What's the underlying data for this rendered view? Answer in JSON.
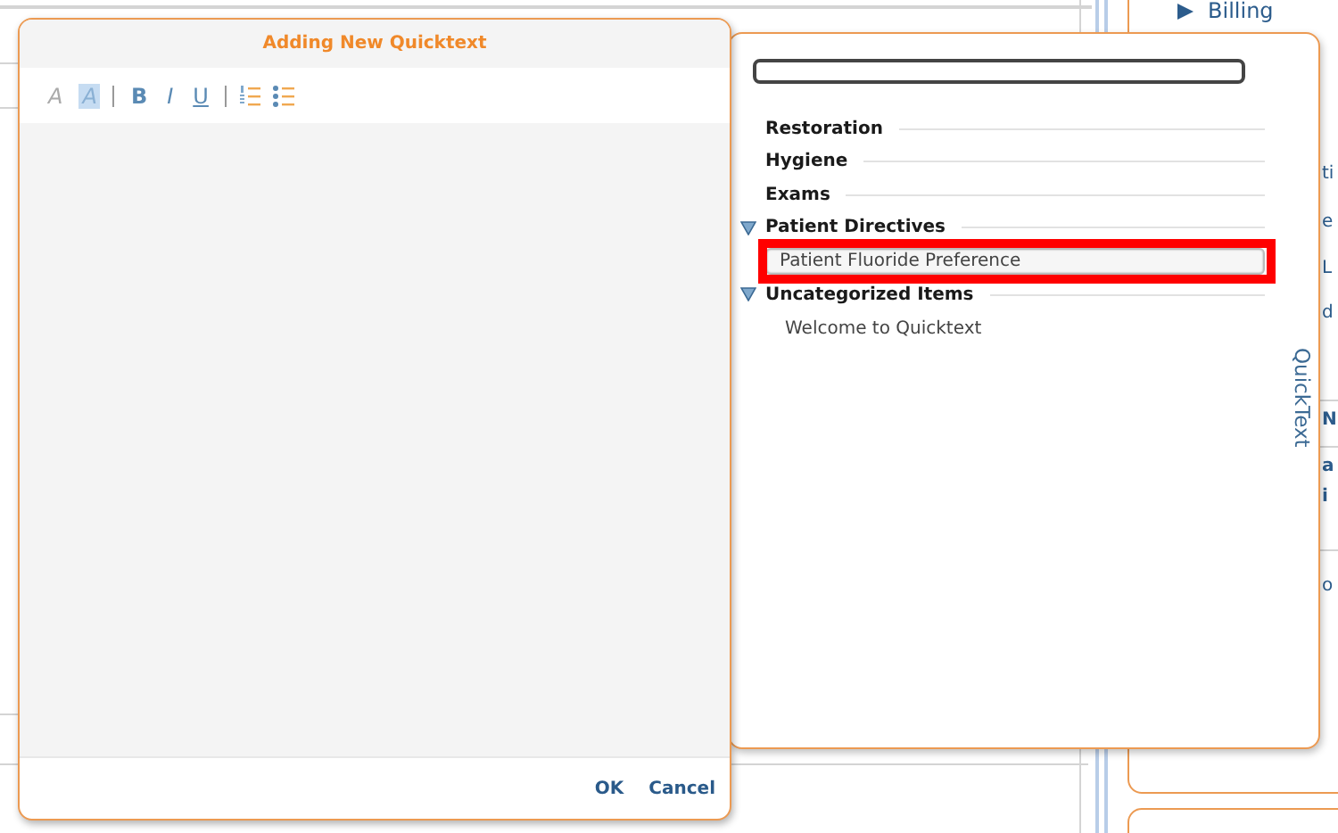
{
  "background": {
    "nav_item": "Billing",
    "fragments": [
      "ti",
      "e",
      "L",
      "d",
      "N",
      "a",
      "i",
      "o"
    ]
  },
  "dialog": {
    "title": "Adding New Quicktext",
    "toolbar": [
      {
        "kind": "fontcolor",
        "label": "A"
      },
      {
        "kind": "highlight",
        "label": "A"
      },
      {
        "kind": "separator"
      },
      {
        "kind": "bold",
        "label": "B"
      },
      {
        "kind": "italic",
        "label": "I"
      },
      {
        "kind": "underline",
        "label": "U"
      },
      {
        "kind": "separator"
      },
      {
        "kind": "numbered-list"
      },
      {
        "kind": "bullet-list"
      }
    ],
    "buttons": [
      "OK",
      "Cancel"
    ]
  },
  "quicktext_panel": {
    "tab_label": "QuickText",
    "categories": [
      {
        "label": "Restoration",
        "expanded": false
      },
      {
        "label": "Hygiene",
        "expanded": false
      },
      {
        "label": "Exams",
        "expanded": false
      },
      {
        "label": "Patient Directives",
        "expanded": true,
        "children": [
          {
            "label": "Patient Fluoride Preference",
            "selected": true,
            "highlighted": true
          }
        ]
      },
      {
        "label": "Uncategorized Items",
        "expanded": true,
        "children": [
          {
            "label": "Welcome to Quicktext",
            "selected": false,
            "highlighted": false
          }
        ]
      }
    ]
  }
}
